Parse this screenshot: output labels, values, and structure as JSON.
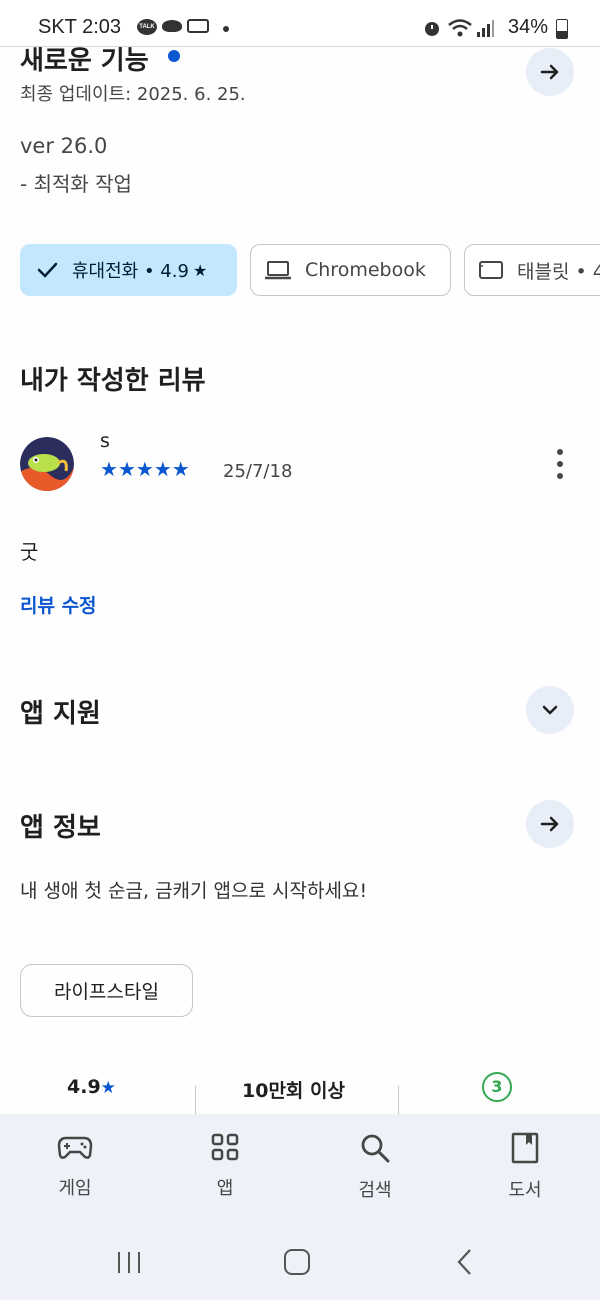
{
  "status_bar": {
    "carrier_time": "SKT 2:03",
    "talk_icon_text": "TALK",
    "battery": "34%"
  },
  "whats_new": {
    "title": "새로운 기능",
    "updated": "최종 업데이트: 2025. 6. 25.",
    "version": "ver 26.0",
    "notes": "- 최적화 작업"
  },
  "device_chips": [
    {
      "label": "휴대전화 • 4.9",
      "icon": "check-icon",
      "selected": true
    },
    {
      "label": "Chromebook",
      "icon": "laptop-icon",
      "selected": false
    },
    {
      "label": "태블릿 • 4",
      "icon": "tablet-icon",
      "selected": false
    }
  ],
  "my_review": {
    "heading": "내가 작성한 리뷰",
    "user_name": "s",
    "rating": 5,
    "date": "25/7/18",
    "text": "굿",
    "edit_label": "리뷰 수정"
  },
  "app_support": {
    "heading": "앱 지원"
  },
  "app_info": {
    "heading": "앱 정보",
    "description": "내 생애 첫 순금, 금캐기 앱으로 시작하세요!",
    "category": "라이프스타일"
  },
  "stats": {
    "rating": "4.9",
    "downloads": "10만회 이상",
    "age_rating": "3"
  },
  "bottom_nav": [
    {
      "label": "게임",
      "icon": "gamepad-icon"
    },
    {
      "label": "앱",
      "icon": "apps-grid-icon"
    },
    {
      "label": "검색",
      "icon": "search-icon"
    },
    {
      "label": "도서",
      "icon": "book-icon"
    }
  ],
  "colors": {
    "accent": "#0b57d0",
    "chip_selected": "#c2e7ff",
    "nav_bg": "#eef1f7",
    "age_green": "#34a853"
  }
}
